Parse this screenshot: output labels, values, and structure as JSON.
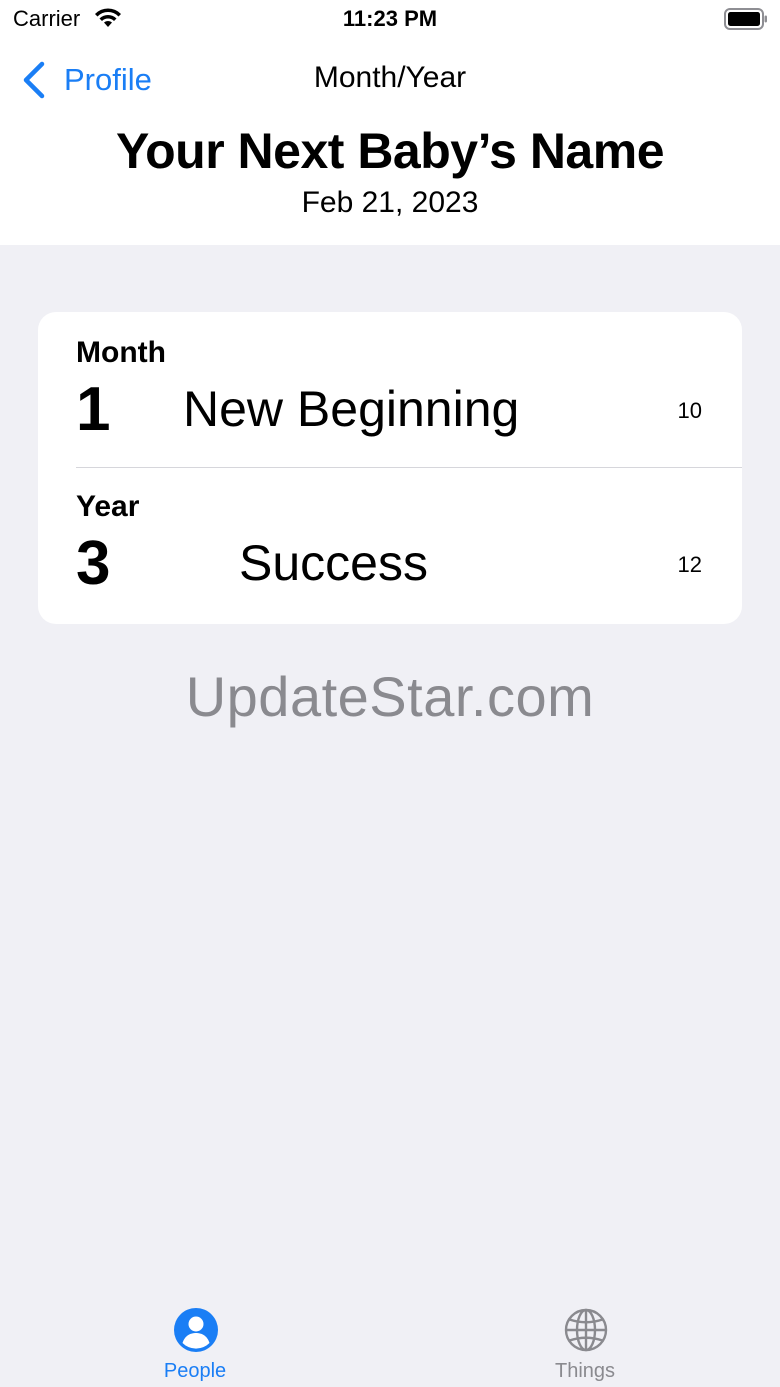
{
  "status_bar": {
    "carrier": "Carrier",
    "time": "11:23 PM",
    "icons": [
      "wifi-icon",
      "battery-icon"
    ]
  },
  "nav": {
    "back_label": "Profile",
    "back_icon": "chevron-left-icon",
    "title": "Month/Year"
  },
  "header": {
    "title": "Your Next Baby’s Name",
    "date": "Feb 21, 2023"
  },
  "rows": [
    {
      "label": "Month",
      "number": "1",
      "meaning": "New Beginning",
      "count": "10"
    },
    {
      "label": "Year",
      "number": "3",
      "meaning": "Success",
      "count": "12"
    }
  ],
  "watermark": "UpdateStar.com",
  "tabs": [
    {
      "label": "People",
      "icon": "person-icon",
      "selected": true
    },
    {
      "label": "Things",
      "icon": "globe-icon",
      "selected": false
    }
  ],
  "colors": {
    "accent": "#1a7ef5",
    "background": "#f0f0f5",
    "inactive": "#8a8a8f"
  }
}
